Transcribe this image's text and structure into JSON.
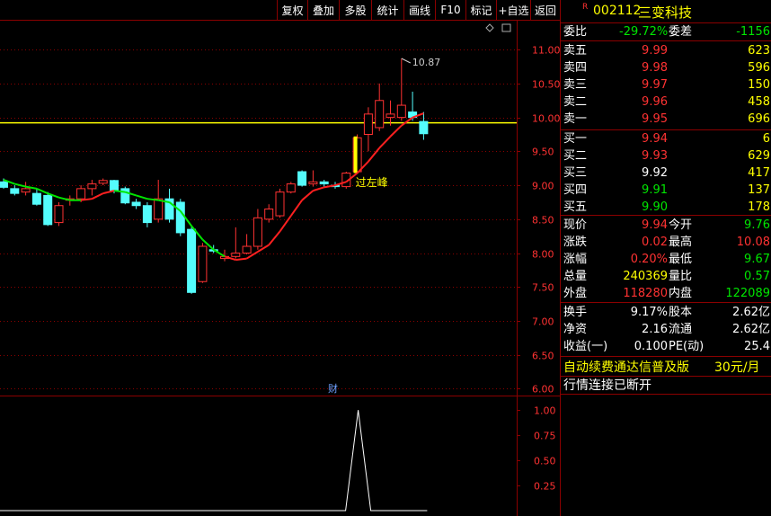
{
  "toolbar": [
    {
      "label": "复权",
      "name": "fuquan-button"
    },
    {
      "label": "叠加",
      "name": "diejia-button"
    },
    {
      "label": "多股",
      "name": "duogu-button"
    },
    {
      "label": "统计",
      "name": "tongji-button"
    },
    {
      "label": "画线",
      "name": "huaxian-button"
    },
    {
      "label": "F10",
      "name": "f10-button"
    },
    {
      "label": "标记",
      "name": "biaoji-button"
    },
    {
      "label": "+自选",
      "name": "add-watchlist-button"
    },
    {
      "label": "返回",
      "name": "back-button"
    }
  ],
  "chart": {
    "price_ticks": [
      "11.00",
      "10.50",
      "10.00",
      "9.50",
      "9.00",
      "8.50",
      "8.00",
      "7.50",
      "7.00",
      "6.50",
      "6.00"
    ],
    "indicator_ticks": [
      "1.00",
      "0.75",
      "0.50",
      "0.25"
    ],
    "high_annotation": "10.87",
    "note_label": "过左峰",
    "cai_marker": "财",
    "colors": {
      "up": "#ff3232",
      "down": "#54fcfc",
      "ma_up": "#ff2020",
      "ma_down": "#00e600",
      "yellow_line": "#ffff00",
      "grid": "#8b0000"
    }
  },
  "chart_data": {
    "type": "candlestick",
    "ylim": [
      5.9,
      11.4
    ],
    "yellow_line": 9.92,
    "candles": [
      {
        "o": 9.05,
        "h": 9.1,
        "l": 8.95,
        "c": 8.97
      },
      {
        "o": 8.95,
        "h": 9.0,
        "l": 8.85,
        "c": 8.88
      },
      {
        "o": 8.9,
        "h": 9.05,
        "l": 8.85,
        "c": 8.95
      },
      {
        "o": 8.88,
        "h": 8.95,
        "l": 8.7,
        "c": 8.72
      },
      {
        "o": 8.85,
        "h": 8.9,
        "l": 8.4,
        "c": 8.42
      },
      {
        "o": 8.45,
        "h": 8.75,
        "l": 8.4,
        "c": 8.7
      },
      {
        "o": 8.78,
        "h": 8.85,
        "l": 8.7,
        "c": 8.8
      },
      {
        "o": 8.8,
        "h": 9.0,
        "l": 8.75,
        "c": 8.95
      },
      {
        "o": 8.95,
        "h": 9.08,
        "l": 8.85,
        "c": 9.02
      },
      {
        "o": 9.03,
        "h": 9.1,
        "l": 9.0,
        "c": 9.07
      },
      {
        "o": 9.07,
        "h": 9.08,
        "l": 8.88,
        "c": 8.92
      },
      {
        "o": 8.95,
        "h": 8.98,
        "l": 8.72,
        "c": 8.74
      },
      {
        "o": 8.75,
        "h": 8.8,
        "l": 8.65,
        "c": 8.7
      },
      {
        "o": 8.7,
        "h": 8.75,
        "l": 8.38,
        "c": 8.45
      },
      {
        "o": 8.5,
        "h": 9.08,
        "l": 8.45,
        "c": 8.8
      },
      {
        "o": 8.8,
        "h": 8.95,
        "l": 8.45,
        "c": 8.5
      },
      {
        "o": 8.75,
        "h": 8.8,
        "l": 8.25,
        "c": 8.3
      },
      {
        "o": 8.35,
        "h": 8.4,
        "l": 7.4,
        "c": 7.42
      },
      {
        "o": 7.58,
        "h": 8.15,
        "l": 7.56,
        "c": 8.1
      },
      {
        "o": 8.05,
        "h": 8.12,
        "l": 8.0,
        "c": 8.03
      },
      {
        "o": 7.92,
        "h": 8.05,
        "l": 7.88,
        "c": 7.95
      },
      {
        "o": 7.95,
        "h": 8.38,
        "l": 7.92,
        "c": 8.0
      },
      {
        "o": 8.0,
        "h": 8.28,
        "l": 7.98,
        "c": 8.1
      },
      {
        "o": 8.1,
        "h": 8.65,
        "l": 8.05,
        "c": 8.52
      },
      {
        "o": 8.5,
        "h": 8.72,
        "l": 8.45,
        "c": 8.65
      },
      {
        "o": 8.55,
        "h": 8.95,
        "l": 8.52,
        "c": 8.9
      },
      {
        "o": 8.9,
        "h": 9.05,
        "l": 8.88,
        "c": 9.02
      },
      {
        "o": 9.2,
        "h": 9.22,
        "l": 8.98,
        "c": 9.0
      },
      {
        "o": 9.02,
        "h": 9.22,
        "l": 8.98,
        "c": 9.05
      },
      {
        "o": 9.05,
        "h": 9.08,
        "l": 8.98,
        "c": 9.02
      },
      {
        "o": 9.0,
        "h": 9.05,
        "l": 8.95,
        "c": 8.98
      },
      {
        "o": 8.98,
        "h": 9.2,
        "l": 8.95,
        "c": 9.18
      },
      {
        "o": 9.2,
        "h": 9.75,
        "l": 9.18,
        "c": 9.7
      },
      {
        "o": 9.75,
        "h": 10.15,
        "l": 9.5,
        "c": 10.05
      },
      {
        "o": 9.85,
        "h": 10.5,
        "l": 9.8,
        "c": 10.25
      },
      {
        "o": 10.0,
        "h": 10.25,
        "l": 9.88,
        "c": 10.05
      },
      {
        "o": 10.0,
        "h": 10.87,
        "l": 9.95,
        "c": 10.18
      },
      {
        "o": 10.08,
        "h": 10.38,
        "l": 9.95,
        "c": 10.0
      },
      {
        "o": 9.94,
        "h": 10.08,
        "l": 9.67,
        "c": 9.76
      }
    ],
    "ma_line": [
      {
        "v": 9.08,
        "up": false
      },
      {
        "v": 9.02,
        "up": false
      },
      {
        "v": 8.98,
        "up": false
      },
      {
        "v": 8.95,
        "up": false
      },
      {
        "v": 8.88,
        "up": false
      },
      {
        "v": 8.82,
        "up": false
      },
      {
        "v": 8.78,
        "up": false
      },
      {
        "v": 8.78,
        "up": false
      },
      {
        "v": 8.8,
        "up": true
      },
      {
        "v": 8.88,
        "up": true
      },
      {
        "v": 8.92,
        "up": true
      },
      {
        "v": 8.9,
        "up": false
      },
      {
        "v": 8.85,
        "up": false
      },
      {
        "v": 8.8,
        "up": false
      },
      {
        "v": 8.78,
        "up": false
      },
      {
        "v": 8.75,
        "up": false
      },
      {
        "v": 8.62,
        "up": false
      },
      {
        "v": 8.4,
        "up": false
      },
      {
        "v": 8.2,
        "up": false
      },
      {
        "v": 8.05,
        "up": false
      },
      {
        "v": 7.95,
        "up": false
      },
      {
        "v": 7.9,
        "up": true
      },
      {
        "v": 7.92,
        "up": true
      },
      {
        "v": 8.02,
        "up": true
      },
      {
        "v": 8.12,
        "up": true
      },
      {
        "v": 8.32,
        "up": true
      },
      {
        "v": 8.55,
        "up": true
      },
      {
        "v": 8.78,
        "up": true
      },
      {
        "v": 8.92,
        "up": true
      },
      {
        "v": 8.97,
        "up": true
      },
      {
        "v": 9.0,
        "up": true
      },
      {
        "v": 9.05,
        "up": true
      },
      {
        "v": 9.18,
        "up": true
      },
      {
        "v": 9.35,
        "up": true
      },
      {
        "v": 9.55,
        "up": true
      },
      {
        "v": 9.72,
        "up": true
      },
      {
        "v": 9.88,
        "up": true
      },
      {
        "v": 10.0,
        "up": true
      },
      {
        "v": 10.06,
        "up": true
      }
    ],
    "indicator": {
      "ylim": [
        0,
        1.1
      ],
      "spike_index": 32,
      "spike_value": 1.0
    }
  },
  "quote": {
    "code": "002112",
    "name": "三变科技",
    "flag": "R",
    "weibi_label": "委比",
    "weibi": "-29.72%",
    "weicha_label": "委差",
    "weicha": "-1156",
    "asks": [
      {
        "label": "卖五",
        "price": "9.99",
        "vol": "623"
      },
      {
        "label": "卖四",
        "price": "9.98",
        "vol": "596"
      },
      {
        "label": "卖三",
        "price": "9.97",
        "vol": "150"
      },
      {
        "label": "卖二",
        "price": "9.96",
        "vol": "458"
      },
      {
        "label": "卖一",
        "price": "9.95",
        "vol": "696"
      }
    ],
    "bids": [
      {
        "label": "买一",
        "price": "9.94",
        "vol": "6",
        "pc": "red"
      },
      {
        "label": "买二",
        "price": "9.93",
        "vol": "629",
        "pc": "red"
      },
      {
        "label": "买三",
        "price": "9.92",
        "vol": "417",
        "pc": "wht"
      },
      {
        "label": "买四",
        "price": "9.91",
        "vol": "137",
        "pc": "grn"
      },
      {
        "label": "买五",
        "price": "9.90",
        "vol": "178",
        "pc": "grn"
      }
    ],
    "stats": [
      {
        "l1": "现价",
        "v1": "9.94",
        "c1": "red",
        "l2": "今开",
        "v2": "9.76",
        "c2": "grn"
      },
      {
        "l1": "涨跌",
        "v1": "0.02",
        "c1": "red",
        "l2": "最高",
        "v2": "10.08",
        "c2": "red"
      },
      {
        "l1": "涨幅",
        "v1": "0.20%",
        "c1": "red",
        "l2": "最低",
        "v2": "9.67",
        "c2": "grn"
      },
      {
        "l1": "总量",
        "v1": "240369",
        "c1": "yel",
        "l2": "量比",
        "v2": "0.57",
        "c2": "grn"
      },
      {
        "l1": "外盘",
        "v1": "118280",
        "c1": "red",
        "l2": "内盘",
        "v2": "122089",
        "c2": "grn"
      }
    ],
    "fin": [
      {
        "l1": "换手",
        "v1": "9.17%",
        "l2": "股本",
        "v2": "2.62亿"
      },
      {
        "l1": "净资",
        "v1": "2.16",
        "l2": "流通",
        "v2": "2.62亿"
      },
      {
        "l1": "收益(一)",
        "v1": "0.100",
        "l2": "PE(动)",
        "v2": "25.4"
      }
    ],
    "ad_text": "自动续费通达信普及版",
    "ad_price": "30元/月",
    "status": "行情连接已断开"
  }
}
